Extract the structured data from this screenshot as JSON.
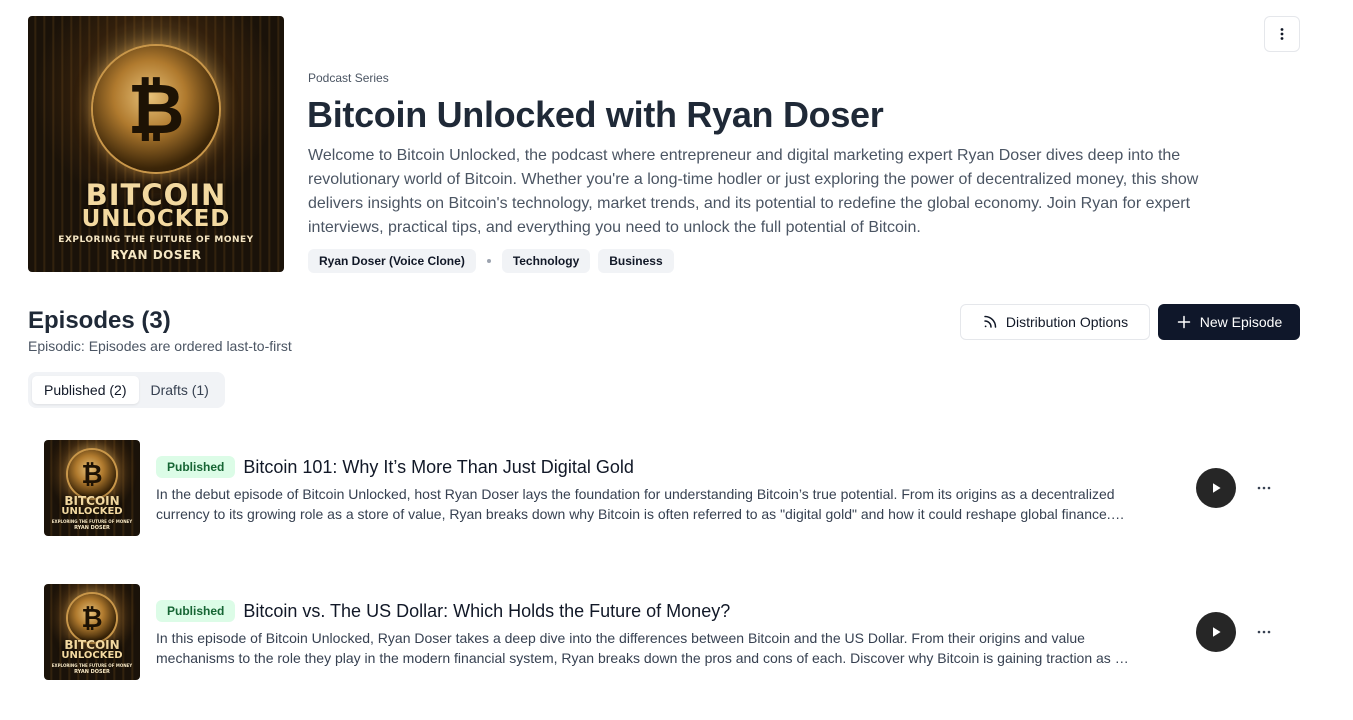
{
  "series": {
    "label": "Podcast Series",
    "title": "Bitcoin Unlocked with Ryan Doser",
    "description": "Welcome to Bitcoin Unlocked, the podcast where entrepreneur and digital marketing expert Ryan Doser dives deep into the revolutionary world of Bitcoin. Whether you're a long-time hodler or just exploring the power of decentralized money, this show delivers insights on Bitcoin's technology, market trends, and its potential to redefine the global economy. Join Ryan for expert interviews, practical tips, and everything you need to unlock the full potential of Bitcoin.",
    "voice_tag": "Ryan Doser (Voice Clone)",
    "category_tags": [
      "Technology",
      "Business"
    ],
    "cover": {
      "coin_symbol": "₿",
      "title_line1": "BITCOIN",
      "title_line2": "UNLOCKED",
      "subtitle": "EXPLORING THE FUTURE OF MONEY",
      "author": "RYAN DOSER"
    }
  },
  "episodes_section": {
    "heading": "Episodes (3)",
    "subtitle": "Episodic: Episodes are ordered last-to-first",
    "distribution_label": "Distribution Options",
    "new_episode_label": "New Episode",
    "tabs": [
      {
        "label": "Published (2)",
        "active": true
      },
      {
        "label": "Drafts (1)",
        "active": false
      }
    ]
  },
  "episodes": [
    {
      "status": "Published",
      "title": "Bitcoin 101: Why It’s More Than Just Digital Gold",
      "desc_line1": "In the debut episode of Bitcoin Unlocked, host Ryan Doser lays the foundation for understanding Bitcoin’s true potential. From its origins as a decentralized",
      "desc_line2": "currency to its growing role as a store of value, Ryan breaks down why Bitcoin is often referred to as \"digital gold\" and how it could reshape global finance.…"
    },
    {
      "status": "Published",
      "title": "Bitcoin vs. The US Dollar: Which Holds the Future of Money?",
      "desc_line1": "In this episode of Bitcoin Unlocked, Ryan Doser takes a deep dive into the differences between Bitcoin and the US Dollar. From their origins and value",
      "desc_line2": "mechanisms to the role they play in the modern financial system, Ryan breaks down the pros and cons of each. Discover why Bitcoin is gaining traction as …"
    }
  ],
  "colors": {
    "primary_button": "#0f172a",
    "published_badge_bg": "#dcfce7",
    "published_badge_text": "#166534",
    "tag_bg": "#f1f3f6"
  },
  "icons": [
    "more-vertical-icon",
    "rss-icon",
    "plus-icon",
    "play-icon",
    "more-horizontal-icon"
  ]
}
